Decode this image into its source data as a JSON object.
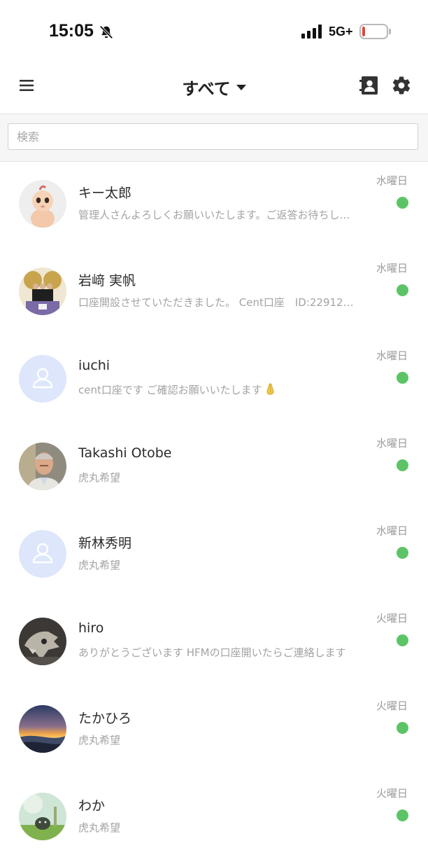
{
  "status_bar": {
    "time": "15:05",
    "network": "5G+",
    "battery_level": 0.12,
    "battery_color": "#e5433a"
  },
  "header": {
    "title": "すべて",
    "menu_icon": "hamburger-menu-icon",
    "contacts_icon": "contacts-book-icon",
    "settings_icon": "gear-icon"
  },
  "search": {
    "placeholder": "検索",
    "value": ""
  },
  "colors": {
    "online": "#5cc466",
    "placeholder_avatar_bg": "#dde6fb",
    "placeholder_avatar_fg": "#ffffff"
  },
  "chats": [
    {
      "name": "キー太郎",
      "preview": "管理人さんよろしくお願いいたします。ご返答お待ちし…",
      "day": "水曜日",
      "online": true,
      "avatar": "baby-figurine-photo"
    },
    {
      "name": "岩﨑 実帆",
      "preview": "口座開設させていただきました。 Cent口座　ID:22912…",
      "day": "水曜日",
      "online": true,
      "avatar": "group-photo"
    },
    {
      "name": "iuchi",
      "preview": "cent口座です ご確認お願いいたします",
      "day": "水曜日",
      "online": true,
      "avatar": "default-person-icon",
      "preview_emoji": "praying-hands-emoji"
    },
    {
      "name": "Takashi Otobe",
      "preview": "虎丸希望",
      "day": "水曜日",
      "online": true,
      "avatar": "man-portrait-photo"
    },
    {
      "name": "新林秀明",
      "preview": "虎丸希望",
      "day": "水曜日",
      "online": true,
      "avatar": "default-person-icon"
    },
    {
      "name": "hiro",
      "preview": "ありがとうございます HFMの口座開いたらご連絡します",
      "day": "火曜日",
      "online": true,
      "avatar": "dinosaur-skull-photo"
    },
    {
      "name": "たかひろ",
      "preview": "虎丸希望",
      "day": "火曜日",
      "online": true,
      "avatar": "sunset-landscape-photo"
    },
    {
      "name": "わか",
      "preview": "虎丸希望",
      "day": "火曜日",
      "online": true,
      "avatar": "nature-scene-photo"
    }
  ]
}
